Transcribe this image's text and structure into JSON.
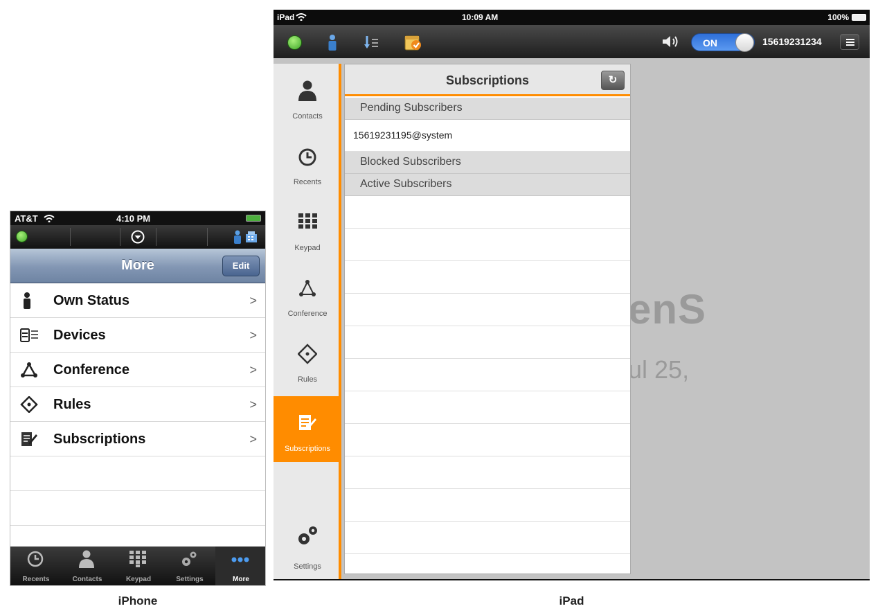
{
  "iphone": {
    "status": {
      "carrier": "AT&T",
      "time": "4:10 PM"
    },
    "nav_title": "More",
    "edit_label": "Edit",
    "rows": [
      {
        "label": "Own Status",
        "icon": "person-icon"
      },
      {
        "label": "Devices",
        "icon": "devices-icon"
      },
      {
        "label": "Conference",
        "icon": "conference-icon"
      },
      {
        "label": "Rules",
        "icon": "rules-icon"
      },
      {
        "label": "Subscriptions",
        "icon": "subscriptions-icon"
      }
    ],
    "tabs": [
      {
        "label": "Recents",
        "icon": "clock-icon"
      },
      {
        "label": "Contacts",
        "icon": "person-icon"
      },
      {
        "label": "Keypad",
        "icon": "keypad-icon"
      },
      {
        "label": "Settings",
        "icon": "gears-icon"
      },
      {
        "label": "More",
        "icon": "more-dots-icon",
        "active": true
      }
    ],
    "caption": "iPhone"
  },
  "ipad": {
    "status": {
      "device": "iPad",
      "time": "10:09 AM",
      "battery": "100%"
    },
    "toggle_label": "ON",
    "number": "15619231234",
    "background_text": {
      "line1": "enS",
      "line2": "ul 25,"
    },
    "sidebar": [
      {
        "label": "Contacts",
        "icon": "person-icon"
      },
      {
        "label": "Recents",
        "icon": "clock-icon"
      },
      {
        "label": "Keypad",
        "icon": "keypad-icon"
      },
      {
        "label": "Conference",
        "icon": "conference-icon"
      },
      {
        "label": "Rules",
        "icon": "rules-icon"
      },
      {
        "label": "Subscriptions",
        "icon": "subscriptions-icon",
        "active": true
      },
      {
        "label": "Settings",
        "icon": "gears-icon"
      }
    ],
    "panel": {
      "title": "Subscriptions",
      "sections": {
        "pending": "Pending Subscribers",
        "pending_items": [
          "15619231195@system"
        ],
        "blocked": "Blocked Subscribers",
        "active": "Active Subscribers"
      }
    },
    "caption": "iPad"
  },
  "colors": {
    "accent": "#ff8c00",
    "nav_blue": "#6e84a3",
    "toggle_blue": "#2e6fd9",
    "status_green": "#4caf3d"
  }
}
